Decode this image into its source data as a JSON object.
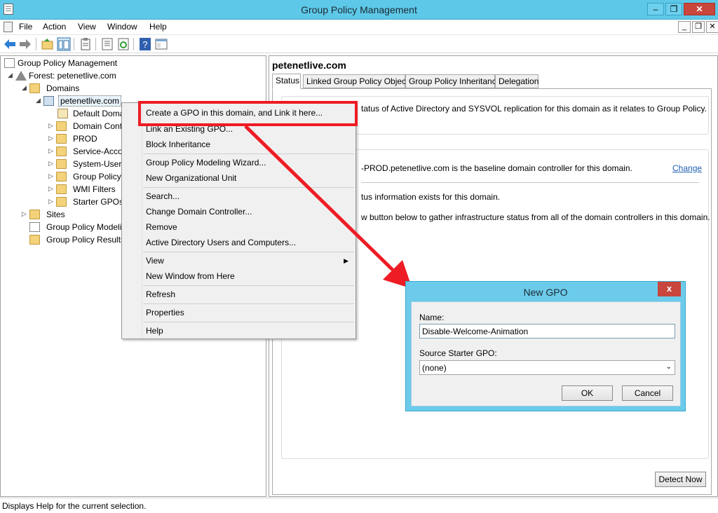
{
  "window": {
    "title": "Group Policy Management",
    "min": "–",
    "max": "❐",
    "close": "✕"
  },
  "menubar": {
    "items": [
      "File",
      "Action",
      "View",
      "Window",
      "Help"
    ],
    "mdi": [
      "_",
      "❐",
      "✕"
    ]
  },
  "toolbar": {
    "icons": [
      "back-arrow-icon",
      "forward-arrow-icon",
      "up-folder-icon",
      "show-hide-tree-icon",
      "clipboard-icon",
      "properties-icon",
      "refresh-icon",
      "help-icon",
      "console-icon"
    ]
  },
  "tree": {
    "root": "Group Policy Management",
    "forest": "Forest: petenetlive.com",
    "domains": "Domains",
    "domain": "petenetlive.com",
    "children": [
      "Default Doma",
      "Domain Cont",
      "PROD",
      "Service-Acco",
      "System-Users",
      "Group Policy",
      "WMI Filters",
      "Starter GPOs"
    ],
    "sites": "Sites",
    "modeling": "Group Policy Modeli",
    "results": "Group Policy Results"
  },
  "right": {
    "title": "petenetlive.com",
    "tabs": [
      "Status",
      "Linked Group Policy Objects",
      "Group Policy Inheritance",
      "Delegation"
    ],
    "line1": "tatus of Active Directory and SYSVOL replication for this domain as it relates to Group Policy.",
    "line2": "-PROD.petenetlive.com is the baseline domain controller for this domain.",
    "change": "Change",
    "line3": "tus information exists for this domain.",
    "line4": "w button below to gather infrastructure status from all of the domain controllers in this domain.",
    "detect": "Detect Now"
  },
  "context_menu": {
    "items": [
      "Create a GPO in this domain, and Link it here...",
      "Link an Existing GPO...",
      "Block Inheritance",
      "Group Policy Modeling Wizard...",
      "New Organizational Unit",
      "Search...",
      "Change Domain Controller...",
      "Remove",
      "Active Directory Users and Computers...",
      "View",
      "New Window from Here",
      "Refresh",
      "Properties",
      "Help"
    ]
  },
  "dialog": {
    "title": "New GPO",
    "close": "x",
    "name_label": "Name:",
    "name_value": "Disable-Welcome-Animation",
    "starter_label": "Source Starter GPO:",
    "starter_value": "(none)",
    "ok": "OK",
    "cancel": "Cancel"
  },
  "status": {
    "text": "Displays Help for the current selection."
  },
  "colors": {
    "titlebar": "#5ec8e8",
    "highlight": "#ee1c24",
    "close": "#c9463c",
    "link": "#1e5fb3"
  }
}
